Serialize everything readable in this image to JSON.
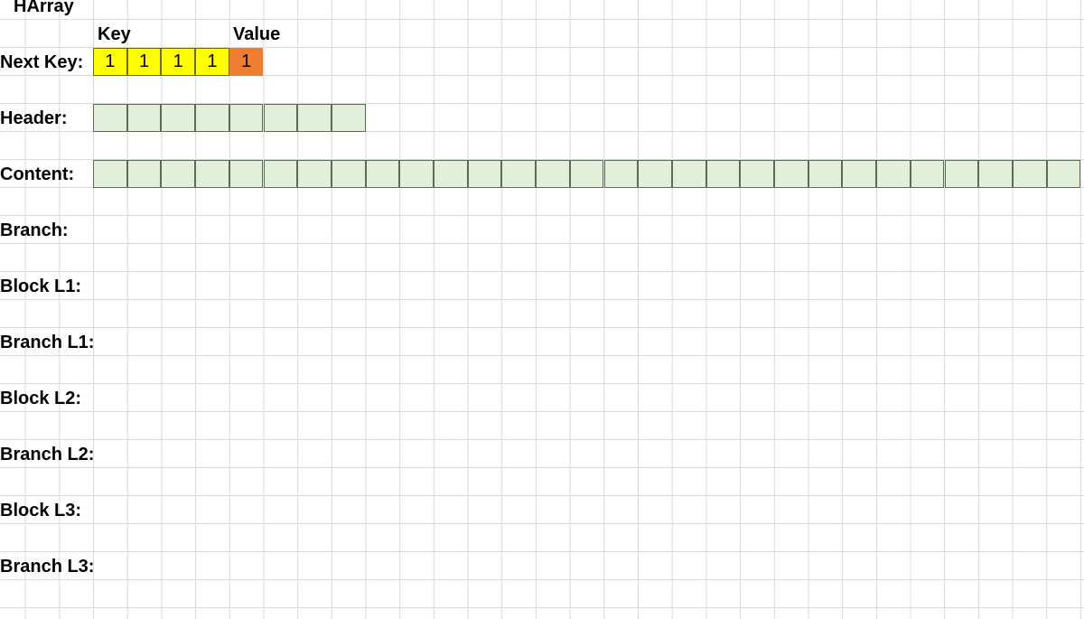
{
  "sheet": {
    "title": "HArray",
    "col_headers": {
      "key": "Key",
      "value": "Value"
    },
    "rows": [
      {
        "id": "next-key",
        "label": "Next Key:"
      },
      {
        "id": "header",
        "label": "Header:"
      },
      {
        "id": "content",
        "label": "Content:"
      },
      {
        "id": "branch",
        "label": "Branch:"
      },
      {
        "id": "block-l1",
        "label": "Block L1:"
      },
      {
        "id": "branch-l1",
        "label": "Branch L1:"
      },
      {
        "id": "block-l2",
        "label": "Block L2:"
      },
      {
        "id": "branch-l2",
        "label": "Branch L2:"
      },
      {
        "id": "block-l3",
        "label": "Block L3:"
      },
      {
        "id": "branch-l3",
        "label": "Branch L3:"
      }
    ],
    "next_key": {
      "key_values": [
        "1",
        "1",
        "1",
        "1"
      ],
      "value": "1"
    },
    "header_cells": 8,
    "content_cells": 29,
    "colors": {
      "key_fill": "#ffff00",
      "value_fill": "#ed7d31",
      "array_fill": "#e2efda"
    }
  }
}
